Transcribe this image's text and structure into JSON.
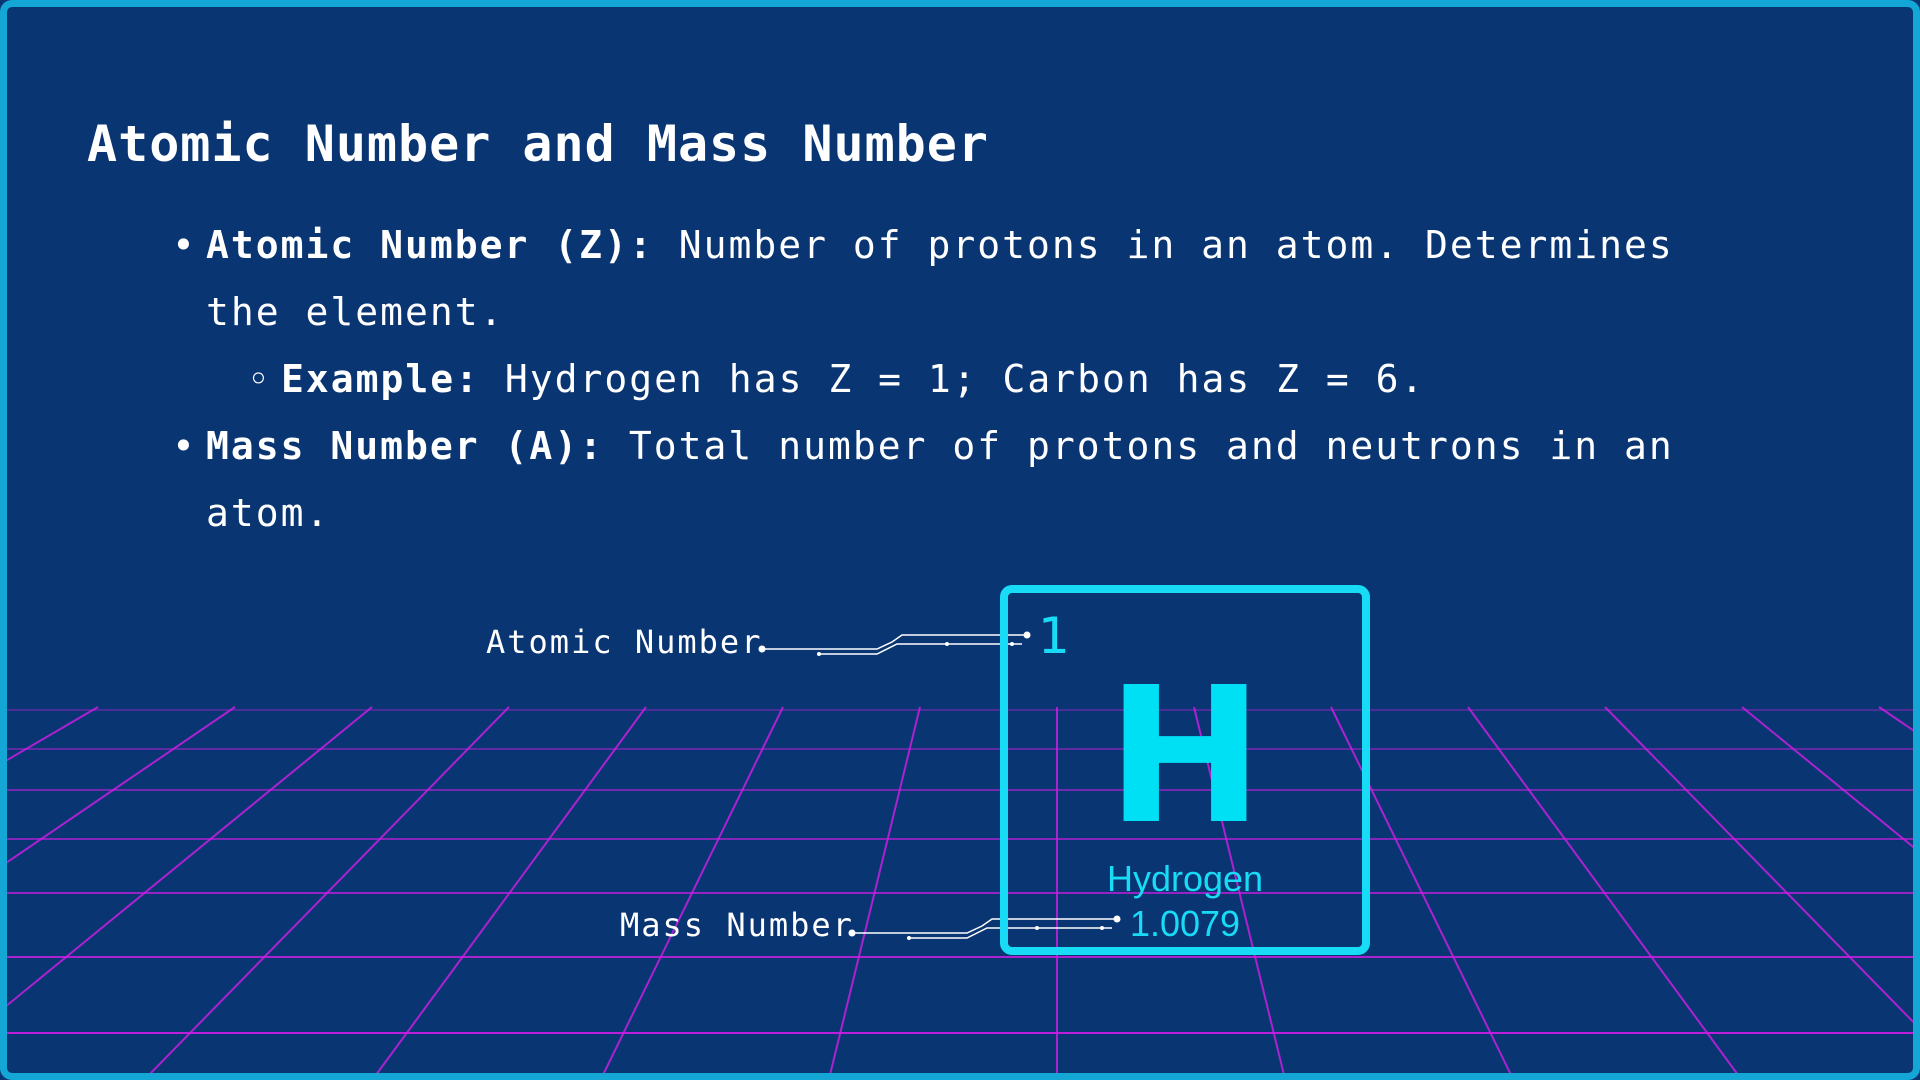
{
  "slide": {
    "title": "Atomic Number and Mass Number",
    "bullets": [
      {
        "term": "Atomic Number (Z):",
        "text": " Number of protons in an atom. Determines the element."
      },
      {
        "term": "Example:",
        "text": " Hydrogen has Z = 1; Carbon has Z = 6."
      },
      {
        "term": "Mass Number (A):",
        "text": " Total number of protons and neutrons in an atom."
      }
    ],
    "bullet_marks": {
      "main": "•",
      "sub": "◦"
    }
  },
  "diagram": {
    "atomic_number_label": "Atomic Number",
    "mass_number_label": "Mass Number",
    "element": {
      "atomic_number": "1",
      "symbol": "H",
      "name": "Hydrogen",
      "mass": "1.0079"
    }
  },
  "colors": {
    "background": "#0a3573",
    "frame": "#14a7d6",
    "accent_cyan": "#18dcf6",
    "grid_magenta": "#c81ee0",
    "text": "#ffffff"
  }
}
